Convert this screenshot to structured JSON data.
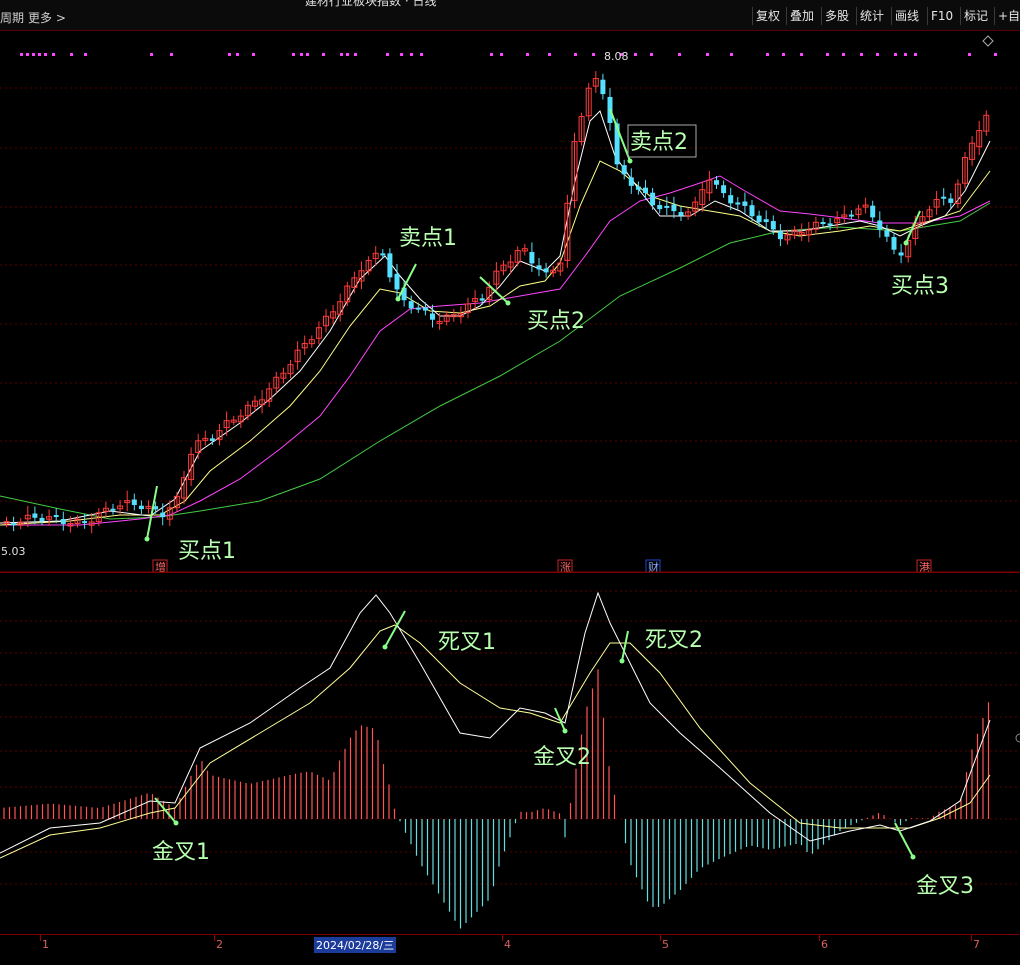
{
  "toolbar": {
    "title": "建材行业板块指数 · 日线",
    "period_label": "周期",
    "more_label": "更多 >",
    "buttons": [
      "复权",
      "叠加",
      "多股",
      "统计",
      "画线",
      "F10",
      "标记",
      "+自"
    ]
  },
  "price_chart": {
    "high_label": "8.08",
    "low_label": "5.03",
    "annotations": {
      "sell1": "卖点1",
      "sell2": "卖点2",
      "buy1": "买点1",
      "buy2": "买点2",
      "buy3": "买点3"
    },
    "event_markers": [
      {
        "label": "增",
        "color": "#cc2222"
      },
      {
        "label": "涨",
        "color": "#cc2222"
      },
      {
        "label": "财",
        "color": "#2244cc"
      },
      {
        "label": "港",
        "color": "#cc2222"
      }
    ],
    "colors": {
      "up": "#ff3b3b",
      "down": "#55e0ff",
      "ma5": "#ffffff",
      "ma10": "#ffff88",
      "ma20": "#ff44ff",
      "ma60": "#44cc44"
    }
  },
  "indicator_chart": {
    "annotations": {
      "death1": "死叉1",
      "death2": "死叉2",
      "golden1": "金叉1",
      "golden2": "金叉2",
      "golden3": "金叉3"
    },
    "colors": {
      "dif": "#ffffff",
      "dea": "#ffff99",
      "pos": "#ff5555",
      "neg": "#66dddd"
    }
  },
  "x_axis": {
    "labels": [
      "1",
      "2",
      "4",
      "5",
      "6",
      "7"
    ],
    "date_label": "2024/02/28/三"
  }
}
